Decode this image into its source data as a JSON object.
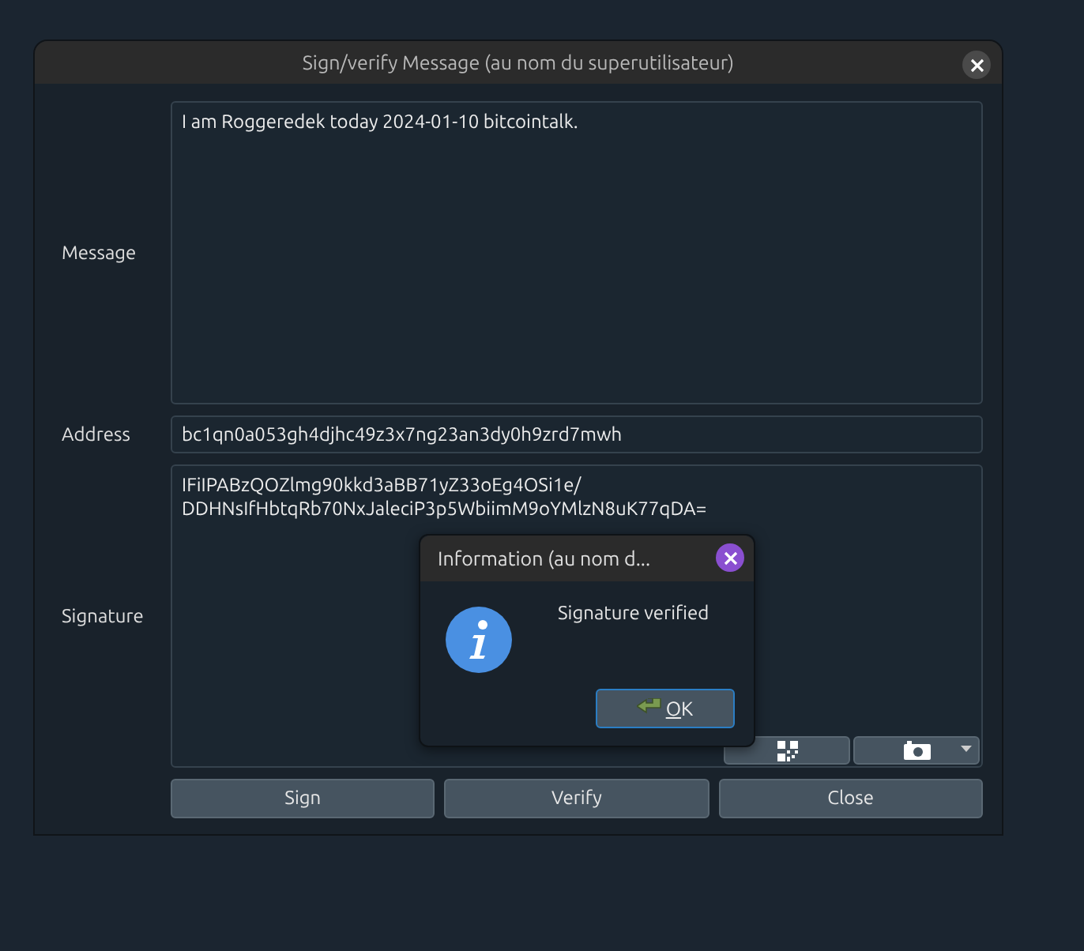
{
  "window": {
    "title": "Sign/verify Message (au nom du superutilisateur)"
  },
  "fields": [
    {
      "label": "Message",
      "kind": "multiline",
      "value": "I am Roggeredek today 2024-01-10 bitcointalk."
    },
    {
      "label": "Address",
      "kind": "line",
      "value": "bc1qn0a053gh4djhc49z3x7ng23an3dy0h9zrd7mwh"
    },
    {
      "label": "Signature",
      "kind": "multiline",
      "value": "IFiIPABzQOZlmg90kkd3aBB71yZ33oEg4OSi1e/\nDDHNsIfHbtqRb70NxJaleciP3p5WbiimM9oYMlzN8uK77qDA="
    }
  ],
  "buttons": [
    "Sign",
    "Verify",
    "Close"
  ],
  "dialog": {
    "title": "Information (au nom d...",
    "message": "Signature verified",
    "button": "OK"
  }
}
